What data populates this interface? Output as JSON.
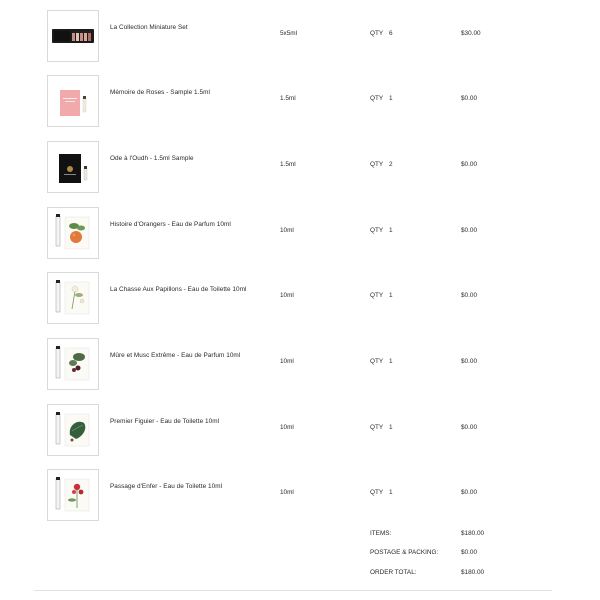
{
  "items": [
    {
      "name": "La Collection Miniature Set",
      "size": "5x5ml",
      "qty_label": "QTY",
      "qty": "6",
      "price": "$30.00",
      "thumb_icon": "miniature-set-box-image"
    },
    {
      "name": "Mémoire de Roses - Sample 1.5ml",
      "size": "1.5ml",
      "qty_label": "QTY",
      "qty": "1",
      "price": "$0.00",
      "thumb_icon": "pink-sample-card-image"
    },
    {
      "name": "Ode à l'Oudh - 1.5ml Sample",
      "size": "1.5ml",
      "qty_label": "QTY",
      "qty": "2",
      "price": "$0.00",
      "thumb_icon": "black-sample-card-image"
    },
    {
      "name": "Histoire d'Orangers - Eau de Parfum 10ml",
      "size": "10ml",
      "qty_label": "QTY",
      "qty": "1",
      "price": "$0.00",
      "thumb_icon": "orange-botanical-image"
    },
    {
      "name": "La Chasse Aux Papillons - Eau de Toilette 10ml",
      "size": "10ml",
      "qty_label": "QTY",
      "qty": "1",
      "price": "$0.00",
      "thumb_icon": "white-flower-botanical-image"
    },
    {
      "name": "Mûre et Musc Extrême - Eau de Parfum 10ml",
      "size": "10ml",
      "qty_label": "QTY",
      "qty": "1",
      "price": "$0.00",
      "thumb_icon": "blackberry-botanical-image"
    },
    {
      "name": "Premier Figuier - Eau de Toilette 10ml",
      "size": "10ml",
      "qty_label": "QTY",
      "qty": "1",
      "price": "$0.00",
      "thumb_icon": "fig-leaf-botanical-image"
    },
    {
      "name": "Passage d'Enfer - Eau de Toilette 10ml",
      "size": "10ml",
      "qty_label": "QTY",
      "qty": "1",
      "price": "$0.00",
      "thumb_icon": "red-lily-botanical-image"
    }
  ],
  "summary": {
    "items_label": "ITEMS:",
    "items_value": "$180.00",
    "postage_label": "POSTAGE & PACKING:",
    "postage_value": "$0.00",
    "total_label": "ORDER TOTAL:",
    "total_value": "$180.00"
  }
}
